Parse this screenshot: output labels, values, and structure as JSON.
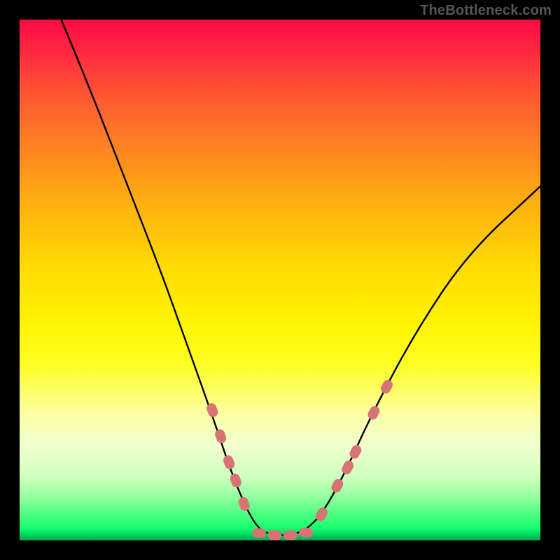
{
  "watermark": "TheBottleneck.com",
  "chart_data": {
    "type": "line",
    "title": "",
    "xlabel": "",
    "ylabel": "",
    "xlim": [
      0,
      100
    ],
    "ylim": [
      0,
      100
    ],
    "background_gradient": {
      "top": "#fe0b48",
      "bottom": "#00a950"
    },
    "series": [
      {
        "name": "bottleneck-curve",
        "type": "path",
        "color": "#000000",
        "points": [
          {
            "x": 8,
            "y": 100
          },
          {
            "x": 13,
            "y": 88
          },
          {
            "x": 20,
            "y": 70
          },
          {
            "x": 27,
            "y": 52
          },
          {
            "x": 32,
            "y": 38
          },
          {
            "x": 37,
            "y": 24
          },
          {
            "x": 41,
            "y": 12
          },
          {
            "x": 45,
            "y": 3
          },
          {
            "x": 48,
            "y": 1
          },
          {
            "x": 52,
            "y": 1
          },
          {
            "x": 55,
            "y": 2
          },
          {
            "x": 58,
            "y": 5
          },
          {
            "x": 62,
            "y": 12
          },
          {
            "x": 68,
            "y": 25
          },
          {
            "x": 76,
            "y": 40
          },
          {
            "x": 86,
            "y": 55
          },
          {
            "x": 100,
            "y": 68
          }
        ]
      },
      {
        "name": "left-segment-markers",
        "type": "capsule-markers",
        "color": "#d77275",
        "points": [
          {
            "x": 37.0,
            "y": 25.0
          },
          {
            "x": 38.6,
            "y": 20.0
          },
          {
            "x": 40.2,
            "y": 15.0
          },
          {
            "x": 41.5,
            "y": 11.5
          },
          {
            "x": 43.1,
            "y": 7.0
          }
        ]
      },
      {
        "name": "valley-markers",
        "type": "capsule-markers",
        "color": "#d77275",
        "points": [
          {
            "x": 46.0,
            "y": 1.4
          },
          {
            "x": 49.0,
            "y": 1.0
          },
          {
            "x": 52.0,
            "y": 1.0
          },
          {
            "x": 55.0,
            "y": 1.5
          }
        ]
      },
      {
        "name": "right-segment-markers",
        "type": "capsule-markers",
        "color": "#d77275",
        "points": [
          {
            "x": 58.0,
            "y": 5.0
          },
          {
            "x": 61.0,
            "y": 10.5
          },
          {
            "x": 63.0,
            "y": 14.0
          },
          {
            "x": 64.5,
            "y": 17.0
          },
          {
            "x": 68.0,
            "y": 24.5
          },
          {
            "x": 70.5,
            "y": 29.5
          }
        ]
      }
    ]
  }
}
